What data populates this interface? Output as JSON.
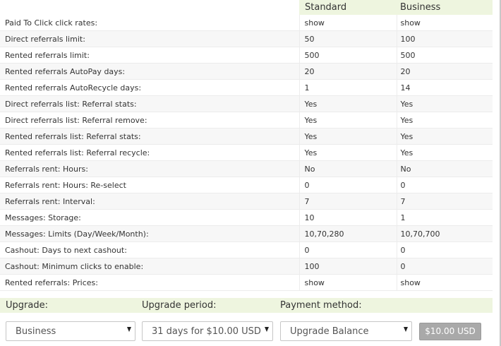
{
  "header": {
    "standard": "Standard",
    "business": "Business"
  },
  "rows": [
    {
      "label": "Paid To Click click rates:",
      "standard": "show",
      "business": "show"
    },
    {
      "label": "Direct referrals limit:",
      "standard": "50",
      "business": "100"
    },
    {
      "label": "Rented referrals limit:",
      "standard": "500",
      "business": "500"
    },
    {
      "label": "Rented referrals AutoPay days:",
      "standard": "20",
      "business": "20"
    },
    {
      "label": "Rented referrals AutoRecycle days:",
      "standard": "1",
      "business": "14"
    },
    {
      "label": "Direct referrals list: Referral stats:",
      "standard": "Yes",
      "business": "Yes"
    },
    {
      "label": "Direct referrals list: Referral remove:",
      "standard": "Yes",
      "business": "Yes"
    },
    {
      "label": "Rented referrals list: Referral stats:",
      "standard": "Yes",
      "business": "Yes"
    },
    {
      "label": "Rented referrals list: Referral recycle:",
      "standard": "Yes",
      "business": "Yes"
    },
    {
      "label": "Referrals rent: Hours:",
      "standard": "No",
      "business": "No"
    },
    {
      "label": "Referrals rent: Hours: Re-select",
      "standard": "0",
      "business": "0"
    },
    {
      "label": "Referrals rent: Interval:",
      "standard": "7",
      "business": "7"
    },
    {
      "label": "Messages: Storage:",
      "standard": "10",
      "business": "1"
    },
    {
      "label": "Messages: Limits (Day/Week/Month):",
      "standard": "10,70,280",
      "business": "10,70,700"
    },
    {
      "label": "Cashout: Days to next cashout:",
      "standard": "0",
      "business": "0"
    },
    {
      "label": "Cashout: Minimum clicks to enable:",
      "standard": "100",
      "business": "0"
    },
    {
      "label": "Rented referrals: Prices:",
      "standard": "show",
      "business": "show"
    }
  ],
  "upgrade": {
    "upgrade_label": "Upgrade:",
    "period_label": "Upgrade period:",
    "payment_label": "Payment method:",
    "upgrade_value": "Business",
    "period_value": "31 days for $10.00 USD",
    "payment_value": "Upgrade Balance",
    "price_button": "$10.00 USD"
  },
  "icons": {
    "dropdown": "chevron-down-icon"
  },
  "colors": {
    "header_bg": "#eef5df",
    "row_alt": "#f7f7f7",
    "button_bg": "#a9a9a9"
  }
}
